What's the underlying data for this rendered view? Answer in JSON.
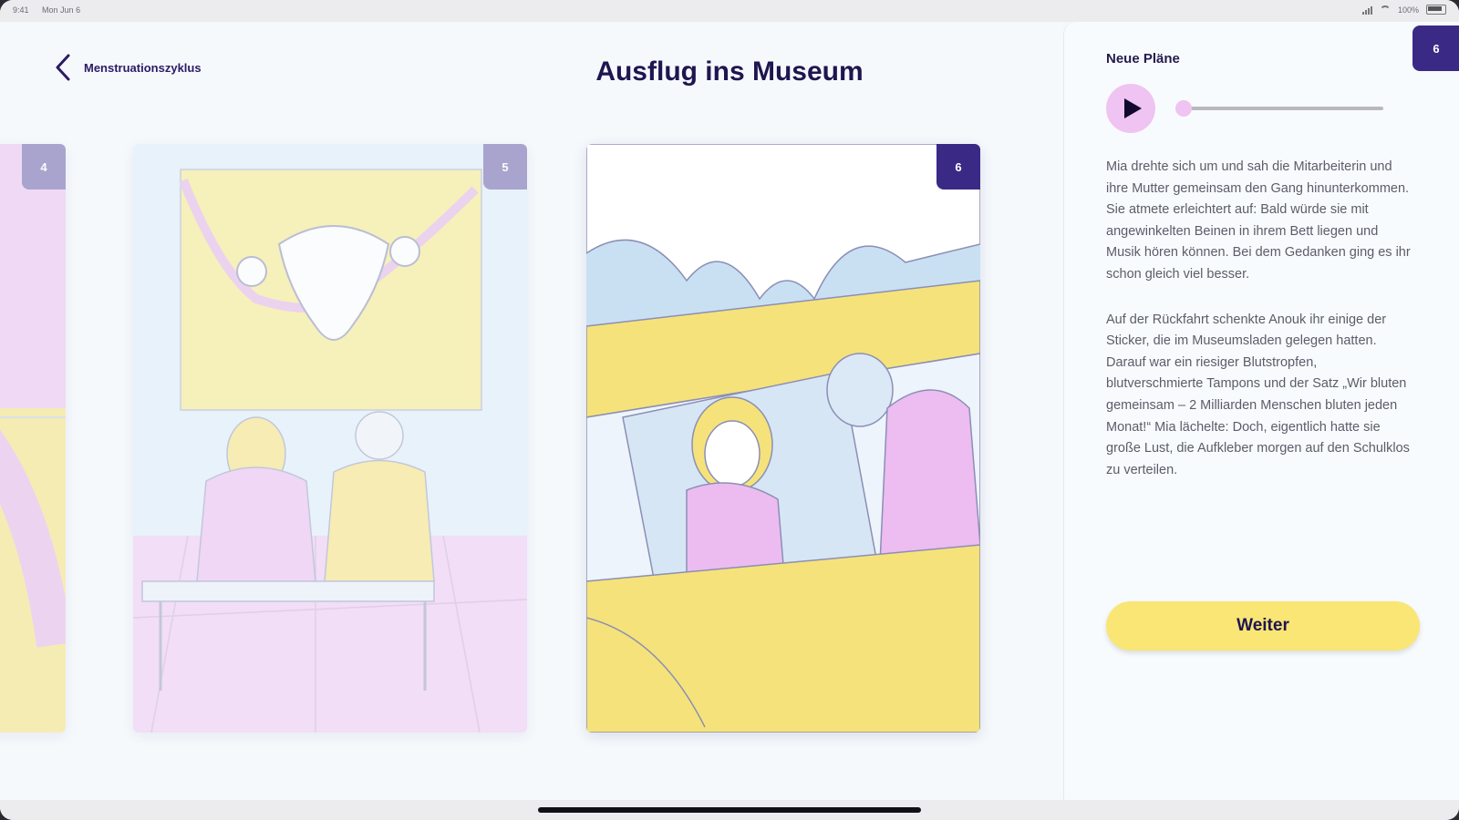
{
  "status_bar": {
    "time": "9:41",
    "date": "Mon Jun 6",
    "battery": "100%"
  },
  "header": {
    "back_label": "Menstruationszyklus",
    "title": "Ausflug ins Museum"
  },
  "cards": [
    {
      "page": "4"
    },
    {
      "page": "5"
    },
    {
      "page": "6"
    }
  ],
  "panel": {
    "page_badge": "6",
    "chapter_title": "Neue Pläne",
    "audio": {
      "progress": 0
    },
    "paragraphs": [
      "Mia drehte sich um und sah die Mitarbeiterin und ihre Mutter gemeinsam den Gang hinunterkommen. Sie atmete erleichtert auf: Bald würde sie mit angewinkelten Beinen in ihrem Bett liegen und Musik hören können. Bei dem Gedanken ging es ihr schon gleich viel besser.",
      "Auf der Rückfahrt schenkte Anouk ihr einige der Sticker, die im Museumsladen gelegen hatten. Darauf war ein riesiger Blutstropfen, blutverschmierte Tampons und der Satz „Wir bluten gemeinsam – 2 Milliarden Menschen bluten jeden Monat!“ Mia lächelte: Doch, eigentlich hatte sie große Lust, die Aufkleber morgen auf den Schulklos zu verteilen."
    ],
    "button_label": "Weiter"
  },
  "colors": {
    "primary": "#3a2a86",
    "title": "#1f1550",
    "accent_yellow": "#f9e675",
    "accent_pink": "#efc3f2",
    "background": "#f5f9fc"
  }
}
